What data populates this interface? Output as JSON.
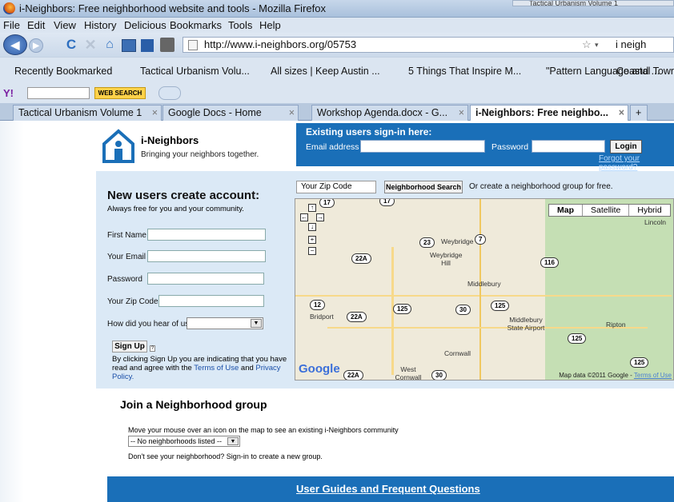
{
  "window": {
    "title": "i-Neighbors: Free neighborhood website and tools - Mozilla Firefox",
    "bg_tab": "Tactical Urbanism Volume 1"
  },
  "menu": [
    "File",
    "Edit",
    "View",
    "History",
    "Delicious",
    "Bookmarks",
    "Tools",
    "Help"
  ],
  "nav": {
    "url": "http://www.i-neighbors.org/05753",
    "search_text": "i neigh"
  },
  "bookmarks": [
    "Recently Bookmarked",
    "Tactical Urbanism Volu...",
    "All sizes | Keep Austin ...",
    "5 Things That Inspire M...",
    "\"Pattern Language and ...",
    "Coastal Towns"
  ],
  "yahoo": {
    "web_search": "WEB SEARCH"
  },
  "tabs": [
    {
      "label": "Tactical Urbanism Volume 1"
    },
    {
      "label": "Google Docs - Home"
    },
    {
      "label": "Workshop Agenda.docx - G..."
    },
    {
      "label": "i-Neighbors: Free neighbo...",
      "active": true
    }
  ],
  "logo": {
    "name": "i-Neighbors",
    "tagline": "Bringing your neighbors together."
  },
  "signin": {
    "heading": "Existing users sign-in here:",
    "email_label": "Email address",
    "password_label": "Password",
    "login": "Login",
    "forgot": "Forgot your password?"
  },
  "signup": {
    "title": "New users create account:",
    "subtitle": "Always free for you and your community.",
    "first_name": "First Name",
    "email": "Your Email",
    "password": "Password",
    "zip": "Your Zip Code",
    "hear": "How did you hear of us?",
    "button": "Sign Up",
    "terms_pre": "By clicking Sign Up you are indicating that you have read and agree with the ",
    "terms_link": "Terms of Use",
    "terms_and": " and ",
    "privacy_link": "Privacy Policy."
  },
  "map": {
    "zip_value": "Your Zip Code",
    "search_button": "Neighborhood Search",
    "or_text": "Or create a neighborhood group for free.",
    "types": [
      "Map",
      "Satellite",
      "Hybrid"
    ],
    "credit": "Map data ©2011 Google -",
    "credit_link": "Terms of Use",
    "google": "Google",
    "towns": [
      "Weybridge",
      "Weybridge Hill",
      "Middlebury",
      "Middlebury State Airport",
      "Bridport",
      "Cornwall",
      "West Cornwall",
      "Ripton",
      "Lincoln"
    ],
    "routes": [
      "17",
      "17",
      "23",
      "7",
      "22A",
      "116",
      "12",
      "125",
      "30",
      "125",
      "22A",
      "125",
      "125",
      "22A",
      "30"
    ]
  },
  "join": {
    "title": "Join a Neighborhood group",
    "hint": "Move your mouse over an icon on the map to see an existing i-Neighbors community",
    "select": "-- No neighborhoods listed --",
    "dont_see": "Don't see your neighborhood? Sign-in to create a new group."
  },
  "footer": {
    "link": "User Guides and Frequent Questions"
  }
}
